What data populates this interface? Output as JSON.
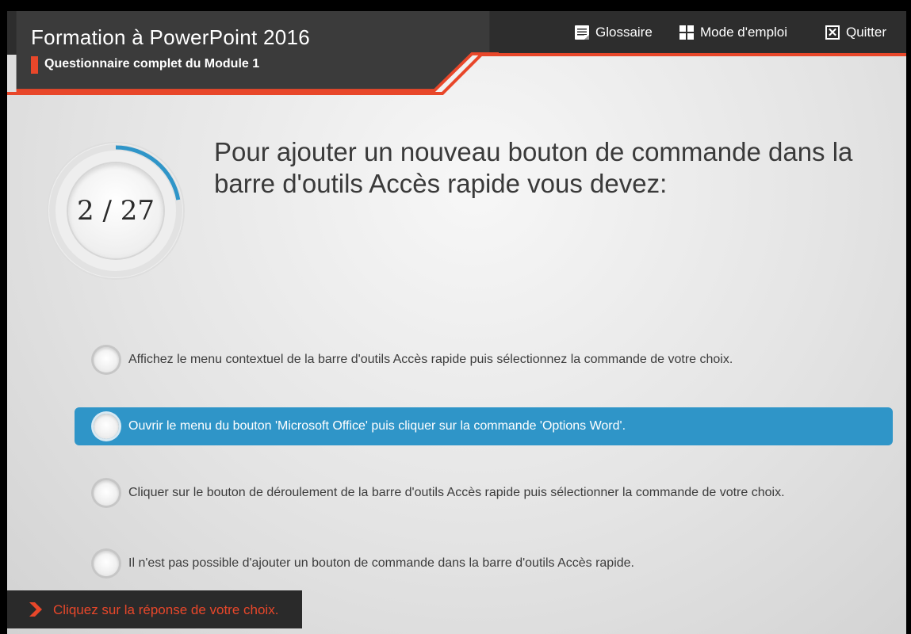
{
  "colors": {
    "accent_red": "#e8472a",
    "dark_header": "#2d2d2d",
    "selected_blue": "#2f95c8",
    "progress_blue": "#2f95c8"
  },
  "header": {
    "title": "Formation à PowerPoint 2016",
    "subtitle": "Questionnaire complet du Module 1"
  },
  "top_menu": {
    "glossary": {
      "label": "Glossaire",
      "icon": "document-icon"
    },
    "manual": {
      "label": "Mode d'emploi",
      "icon": "grid-icon"
    },
    "quit": {
      "label": "Quitter",
      "icon": "close-box-icon"
    }
  },
  "progress": {
    "label": "2 / 27",
    "current": 2,
    "total": 27
  },
  "question": {
    "text": "Pour ajouter un nouveau bouton de commande dans la barre d'outils Accès rapide vous devez:"
  },
  "answers": [
    {
      "text": "Affichez le menu contextuel de la barre d'outils Accès rapide puis sélectionnez la commande de votre choix.",
      "selected": false
    },
    {
      "text": "Ouvrir le menu du bouton 'Microsoft Office' puis cliquer sur la commande 'Options Word'.",
      "selected": true
    },
    {
      "text": "Cliquer sur le bouton de déroulement de la barre d'outils Accès rapide puis sélectionner la commande de votre choix.",
      "selected": false
    },
    {
      "text": "Il n'est pas possible d'ajouter un bouton de commande dans la barre d'outils Accès rapide.",
      "selected": false
    }
  ],
  "footer": {
    "hint": "Cliquez sur la réponse de votre choix.",
    "icon": "chevron-right-icon"
  }
}
